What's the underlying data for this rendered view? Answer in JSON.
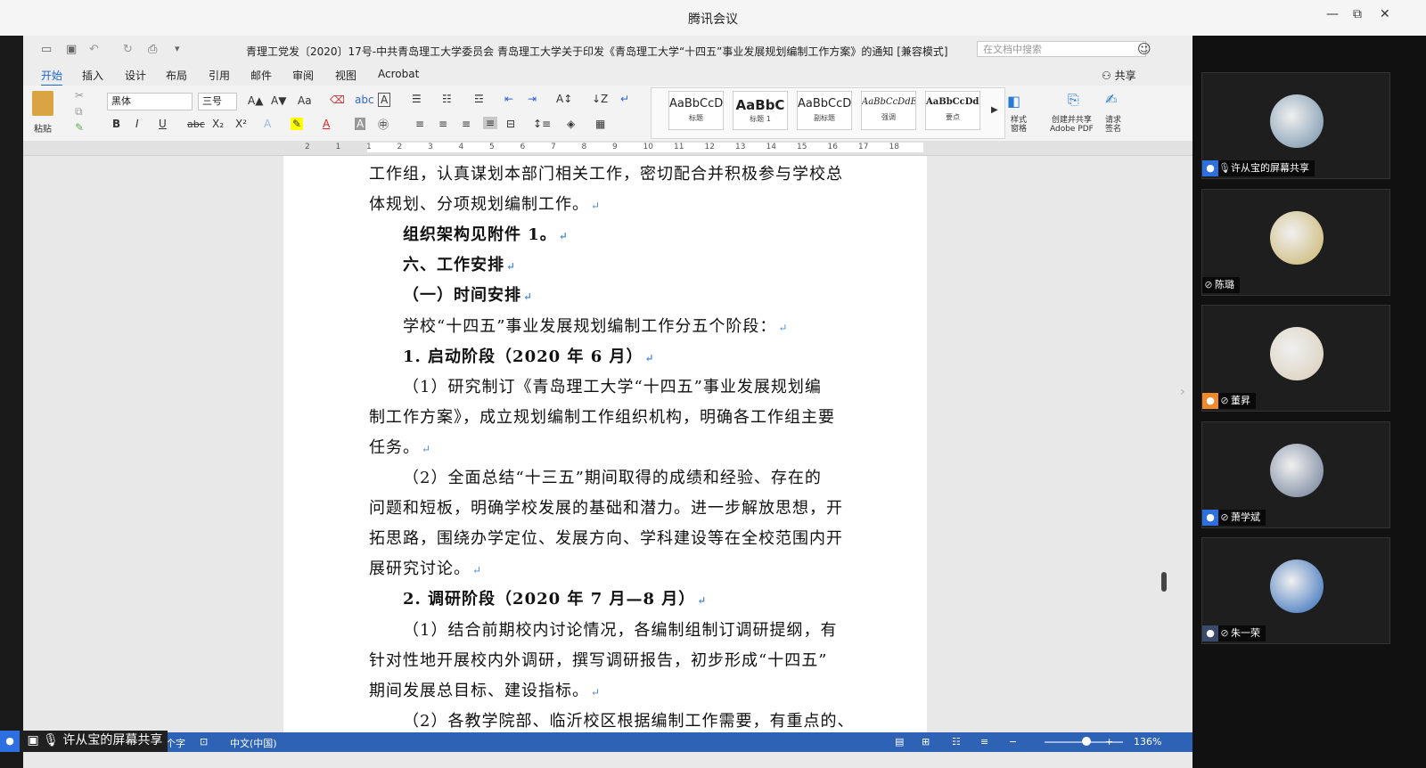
{
  "window": {
    "title": "腾讯会议",
    "minimize": "—",
    "restore": "⧉",
    "close": "✕"
  },
  "word": {
    "doc_title": "青理工党发〔2020〕17号-中共青岛理工大学委员会 青岛理工大学关于印发《青岛理工大学“十四五”事业发展规划编制工作方案》的通知 [兼容模式]",
    "search_placeholder": "在文档中搜索",
    "tabs": [
      "开始",
      "插入",
      "设计",
      "布局",
      "引用",
      "邮件",
      "审阅",
      "视图",
      "Acrobat"
    ],
    "share_label": "共享",
    "ribbon": {
      "paste": "粘贴",
      "font_name": "黑体",
      "font_size": "三号",
      "bold": "B",
      "italic": "I",
      "underline": "U",
      "strike": "abc",
      "subscript": "X₂",
      "superscript": "X²",
      "styles": [
        {
          "sample": "AaBbCcD",
          "name": "标题"
        },
        {
          "sample": "AaBbC",
          "name": "标题 1"
        },
        {
          "sample": "AaBbCcD",
          "name": "副标题"
        },
        {
          "sample": "AaBbCcDdEe",
          "name": "强调"
        },
        {
          "sample": "AaBbCcDdEe",
          "name": "要点"
        }
      ],
      "styles_pane": "样式\n窗格",
      "create_pdf": "创建并共享\nAdobe PDF",
      "request_sign": "请求\n签名"
    },
    "ruler_ticks": [
      "2",
      "1",
      "1",
      "2",
      "3",
      "4",
      "5",
      "6",
      "7",
      "8",
      "9",
      "10",
      "11",
      "12",
      "13",
      "14",
      "15",
      "16",
      "17",
      "18"
    ],
    "document_lines": [
      {
        "text": "工作组，认真谋划本部门相关工作，密切配合并积极参与学校总",
        "bold": false,
        "indent": false
      },
      {
        "text": "体规划、分项规划编制工作。",
        "bold": false,
        "indent": false
      },
      {
        "text": "组织架构见附件 1。",
        "bold": true,
        "indent": true
      },
      {
        "text": "六、工作安排",
        "bold": true,
        "indent": true
      },
      {
        "text": "（一）时间安排",
        "bold": true,
        "indent": true
      },
      {
        "text": "学校“十四五”事业发展规划编制工作分五个阶段：",
        "bold": false,
        "indent": true
      },
      {
        "text": "1. 启动阶段（2020 年 6 月）",
        "bold": true,
        "indent": true
      },
      {
        "text": "（1）研究制订《青岛理工大学“十四五”事业发展规划编",
        "bold": false,
        "indent": true
      },
      {
        "text": "制工作方案》，成立规划编制工作组织机构，明确各工作组主要",
        "bold": false,
        "indent": false
      },
      {
        "text": "任务。",
        "bold": false,
        "indent": false
      },
      {
        "text": "（2）全面总结“十三五”期间取得的成绩和经验、存在的",
        "bold": false,
        "indent": true
      },
      {
        "text": "问题和短板，明确学校发展的基础和潜力。进一步解放思想，开",
        "bold": false,
        "indent": false
      },
      {
        "text": "拓思路，围绕办学定位、发展方向、学科建设等在全校范围内开",
        "bold": false,
        "indent": false
      },
      {
        "text": "展研究讨论。",
        "bold": false,
        "indent": false
      },
      {
        "text": "2. 调研阶段（2020 年 7 月—8 月）",
        "bold": true,
        "indent": true
      },
      {
        "text": "（1）结合前期校内讨论情况，各编制组制订调研提纲，有",
        "bold": false,
        "indent": true
      },
      {
        "text": "针对性地开展校内外调研，撰写调研报告，初步形成“十四五”",
        "bold": false,
        "indent": false
      },
      {
        "text": "期间发展总目标、建设指标。",
        "bold": false,
        "indent": false
      },
      {
        "text": "（2）各教学院部、临沂校区根据编制工作需要，有重点的、",
        "bold": false,
        "indent": true
      }
    ],
    "status": {
      "words": "个字",
      "language": "中文(中国)",
      "zoom": "136%"
    }
  },
  "share_overlay": "许从宝的屏幕共享",
  "participants": [
    {
      "name": "许从宝的屏幕共享",
      "avatar_color": "#6f8fa8",
      "badge": "blue"
    },
    {
      "name": "陈璐",
      "avatar_color": "#c9b36a",
      "badge": "none"
    },
    {
      "name": "董昇",
      "avatar_color": "#d8cdb8",
      "badge": "orange"
    },
    {
      "name": "萧学斌",
      "avatar_color": "#6a7a94",
      "badge": "blue"
    },
    {
      "name": "朱一荣",
      "avatar_color": "#2a66b8",
      "badge": "gray"
    }
  ]
}
